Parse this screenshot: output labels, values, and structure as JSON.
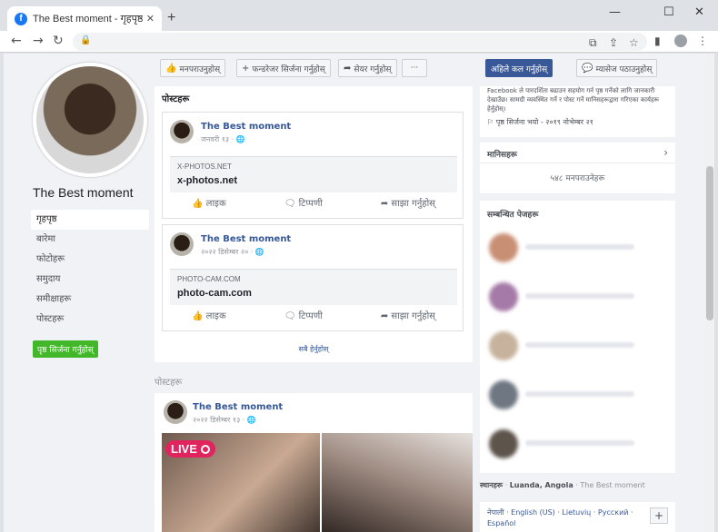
{
  "browser": {
    "tab_title": "The Best moment - गृहपृष्ठ | Facebook",
    "tab_close": "✕",
    "new_tab": "+",
    "win_min": "—",
    "win_max": "☐",
    "win_close": "✕",
    "back": "←",
    "forward": "→",
    "reload": "↻"
  },
  "profile": {
    "name": "The Best moment",
    "nav": [
      "गृहपृष्ठ",
      "बारेमा",
      "फोटोहरू",
      "समुदाय",
      "समीक्षाहरू",
      "पोस्टहरू"
    ],
    "create_page": "पृष्ठ सिर्जना गर्नुहोस्"
  },
  "actions": {
    "like": "मनपराउनुहोस्",
    "fundraiser": "फन्डरेजर सिर्जना गर्नुहोस्",
    "share": "सेयर गर्नुहोस्",
    "more": "···",
    "call": "अहिले कल गर्नुहोस्",
    "message": "म्यासेज पठाउनुहोस्"
  },
  "feed": {
    "heading": "पोस्टहरू",
    "posts": [
      {
        "author": "The Best moment",
        "date": "जनवरी १३ · ",
        "domain": "X-PHOTOS.NET",
        "title": "x-photos.net"
      },
      {
        "author": "The Best moment",
        "date": "२०२२ डिसेम्बर २० · ",
        "domain": "PHOTO-CAM.COM",
        "title": "photo-cam.com"
      }
    ],
    "like": "लाइक",
    "comment": "टिप्पणी",
    "share": "साझा गर्नुहोस्",
    "see_all": "सबै हेर्नुहोस्"
  },
  "posts_section": {
    "label": "पोस्टहरू",
    "author": "The Best moment",
    "date": "२०२२ डिसेम्बर १३ · ",
    "live": "LIVE"
  },
  "right": {
    "about": "Facebook ले पारदर्शिता बढाउन सहयोग गर्न पृष्ठ गर्नेको लागि जानकारी देखाउँछ। सामग्री व्यवस्थित गर्ने र पोस्ट गर्ने मानिसहरूद्वारा गरिएका कार्यहरू हेर्नुहोस्।",
    "created": "पृष्ठ सिर्जना भयो - २०१९ नोभेम्बर २१",
    "people_heading": "मानिसहरू",
    "likes": "५४८ मनपराउनेहरू",
    "related_heading": "सम्बन्धित पेजहरू",
    "places_label": "स्थानहरू",
    "place": "Luanda, Angola",
    "place_page": "The Best moment",
    "languages": "नेपाली · English (US) · Lietuvių · Русский · Español",
    "add": "+"
  }
}
